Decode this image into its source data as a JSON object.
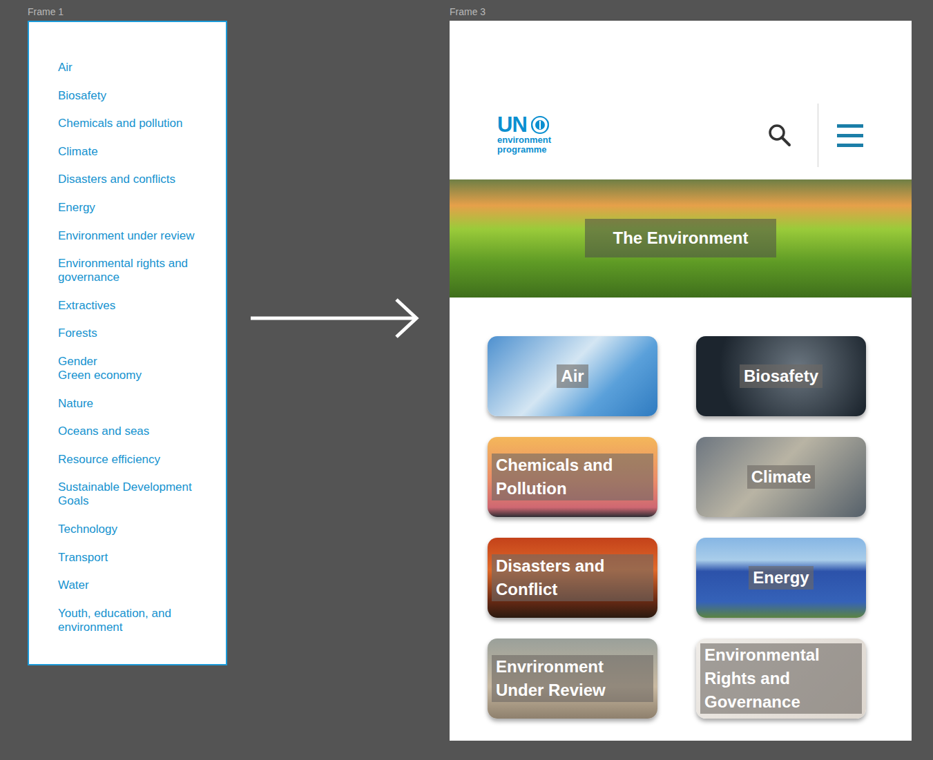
{
  "canvas": {
    "frames": [
      {
        "label": "Frame 1"
      },
      {
        "label": "Frame 3"
      }
    ]
  },
  "topic_list": {
    "items": [
      "Air",
      "Biosafety",
      "Chemicals and pollution",
      "Climate",
      "Disasters and conflicts",
      "Energy",
      "Environment under review",
      "Environmental rights and governance",
      "Extractives",
      "Forests",
      "Gender\nGreen economy",
      "Nature",
      "Oceans and seas",
      "Resource efficiency",
      "Sustainable Development Goals",
      "Technology",
      "Transport",
      "Water",
      "Youth, education, and environment"
    ]
  },
  "page": {
    "logo": {
      "wordmark": "UN",
      "line1": "environment",
      "line2": "programme"
    },
    "hero": {
      "title": "The Environment"
    },
    "cards": [
      {
        "title": "Air"
      },
      {
        "title": "Biosafety"
      },
      {
        "title": "Chemicals and Pollution"
      },
      {
        "title": "Climate"
      },
      {
        "title": "Disasters and Conflict"
      },
      {
        "title": "Energy"
      },
      {
        "title": "Envrironment Under Review"
      },
      {
        "title": "Environmental Rights and Governance"
      }
    ]
  }
}
